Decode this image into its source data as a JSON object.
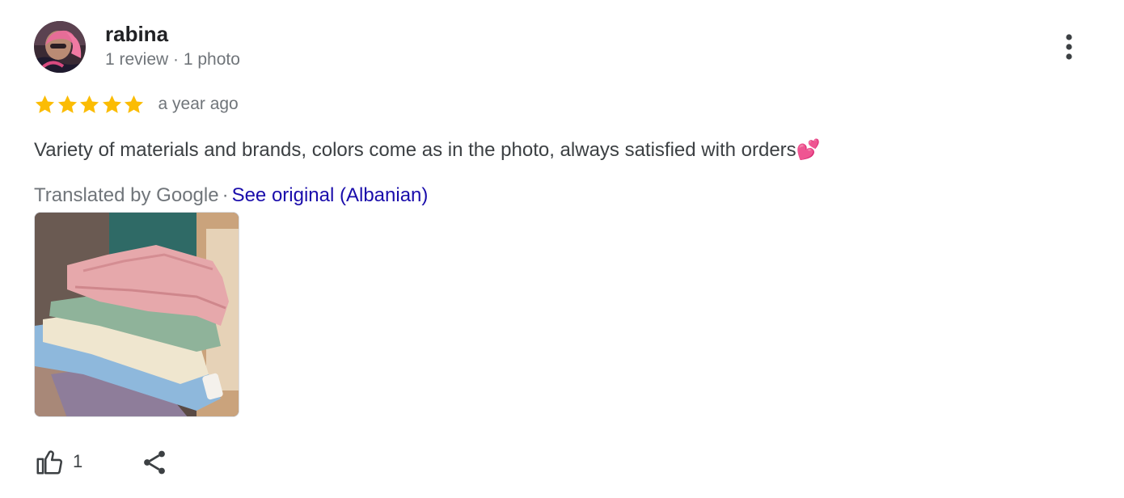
{
  "review": {
    "author": {
      "name": "rabina",
      "meta": "1 review · 1 photo"
    },
    "rating": 5,
    "time_ago": "a year ago",
    "text": "Variety of materials and brands, colors come as in the photo, always satisfied with orders💕",
    "translation": {
      "label": "Translated by Google",
      "separator": "·",
      "see_original": "See original (Albanian)"
    },
    "likes": "1"
  },
  "icons": {
    "menu": "more-vert-icon",
    "like": "thumb-up-icon",
    "share": "share-icon",
    "star": "star-icon"
  },
  "colors": {
    "star": "#fbbc04",
    "link": "#1a0dab",
    "secondary_text": "#70757a",
    "body_text": "#3c4043"
  }
}
